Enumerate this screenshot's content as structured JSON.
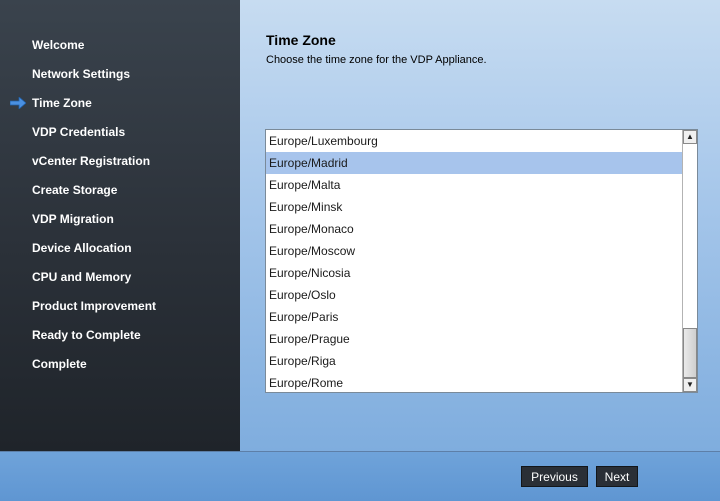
{
  "sidebar": {
    "items": [
      {
        "label": "Welcome"
      },
      {
        "label": "Network Settings"
      },
      {
        "label": "Time Zone",
        "current": true
      },
      {
        "label": "VDP Credentials"
      },
      {
        "label": "vCenter Registration"
      },
      {
        "label": "Create Storage"
      },
      {
        "label": "VDP Migration"
      },
      {
        "label": "Device Allocation"
      },
      {
        "label": "CPU and Memory"
      },
      {
        "label": "Product Improvement"
      },
      {
        "label": "Ready to Complete"
      },
      {
        "label": "Complete"
      }
    ],
    "current_icon": "right-arrow-icon"
  },
  "main": {
    "title": "Time Zone",
    "subtitle": "Choose the time zone for the VDP Appliance.",
    "timezone_list": {
      "items": [
        "Europe/Luxembourg",
        "Europe/Madrid",
        "Europe/Malta",
        "Europe/Minsk",
        "Europe/Monaco",
        "Europe/Moscow",
        "Europe/Nicosia",
        "Europe/Oslo",
        "Europe/Paris",
        "Europe/Prague",
        "Europe/Riga",
        "Europe/Rome"
      ],
      "selected": "Europe/Madrid",
      "scroll_up_icon": "scroll-up-icon",
      "scroll_down_icon": "scroll-down-icon"
    }
  },
  "footer": {
    "previous_label": "Previous",
    "next_label": "Next"
  },
  "colors": {
    "sidebar_bg": "#2b3139",
    "selected_row": "#a7c4ec",
    "content_bg": "#a5c6ea",
    "button_bg": "#2a2f36",
    "arrow": "#4a90e2"
  }
}
